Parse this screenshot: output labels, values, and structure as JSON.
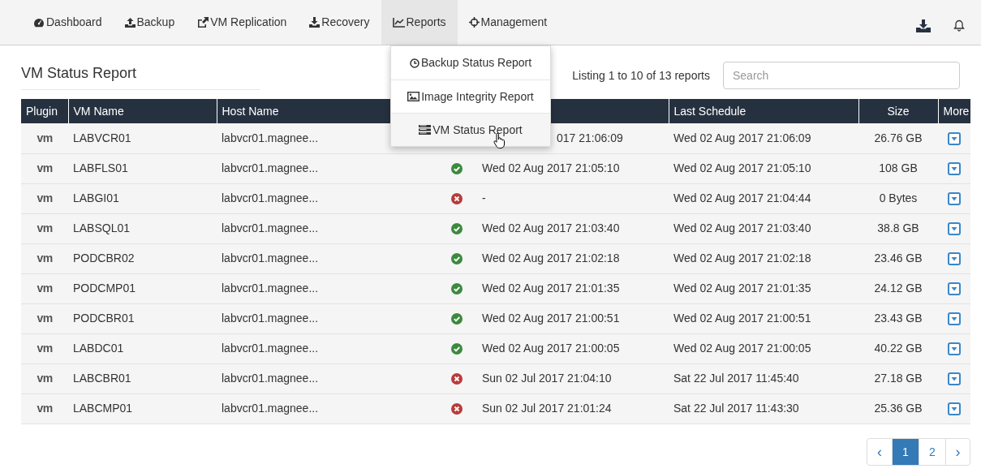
{
  "nav": {
    "items": [
      {
        "label": "Dashboard",
        "selected": false
      },
      {
        "label": "Backup",
        "selected": false
      },
      {
        "label": "VM Replication",
        "selected": false
      },
      {
        "label": "Recovery",
        "selected": false
      },
      {
        "label": "Reports",
        "selected": true
      },
      {
        "label": "Management",
        "selected": false
      }
    ]
  },
  "reports_menu": {
    "items": [
      {
        "label": "Backup Status Report",
        "selected": false
      },
      {
        "label": "Image Integrity Report",
        "selected": false
      },
      {
        "label": "VM Status Report",
        "selected": true
      }
    ]
  },
  "page_title": "VM Status Report",
  "listing": "Listing 1 to 10 of 13 reports",
  "search": {
    "placeholder": "Search"
  },
  "table": {
    "columns": [
      "Plugin",
      "VM Name",
      "Host Name",
      "Last Schedule",
      "Size",
      "More"
    ],
    "rows": [
      {
        "plugin": "vm",
        "vm_name": "LABVCR01",
        "host": "labvcr01.magnee...",
        "last_run": "017 21:06:09",
        "last_schedule": "Wed 02 Aug 2017 21:06:09",
        "size": "26.76 GB"
      },
      {
        "plugin": "vm",
        "vm_name": "LABFLS01",
        "host": "labvcr01.magnee...",
        "succeeded": true,
        "last_run": "Wed 02 Aug 2017 21:05:10",
        "last_schedule": "Wed 02 Aug 2017 21:05:10",
        "size": "108 GB"
      },
      {
        "plugin": "vm",
        "vm_name": "LABGI01",
        "host": "labvcr01.magnee...",
        "succeeded": false,
        "last_run": "-",
        "last_schedule": "Wed 02 Aug 2017 21:04:44",
        "size": "0 Bytes"
      },
      {
        "plugin": "vm",
        "vm_name": "LABSQL01",
        "host": "labvcr01.magnee...",
        "succeeded": true,
        "last_run": "Wed 02 Aug 2017 21:03:40",
        "last_schedule": "Wed 02 Aug 2017 21:03:40",
        "size": "38.8 GB"
      },
      {
        "plugin": "vm",
        "vm_name": "PODCBR02",
        "host": "labvcr01.magnee...",
        "succeeded": true,
        "last_run": "Wed 02 Aug 2017 21:02:18",
        "last_schedule": "Wed 02 Aug 2017 21:02:18",
        "size": "23.46 GB"
      },
      {
        "plugin": "vm",
        "vm_name": "PODCMP01",
        "host": "labvcr01.magnee...",
        "succeeded": true,
        "last_run": "Wed 02 Aug 2017 21:01:35",
        "last_schedule": "Wed 02 Aug 2017 21:01:35",
        "size": "24.12 GB"
      },
      {
        "plugin": "vm",
        "vm_name": "PODCBR01",
        "host": "labvcr01.magnee...",
        "succeeded": true,
        "last_run": "Wed 02 Aug 2017 21:00:51",
        "last_schedule": "Wed 02 Aug 2017 21:00:51",
        "size": "23.43 GB"
      },
      {
        "plugin": "vm",
        "vm_name": "LABDC01",
        "host": "labvcr01.magnee...",
        "succeeded": true,
        "last_run": "Wed 02 Aug 2017 21:00:05",
        "last_schedule": "Wed 02 Aug 2017 21:00:05",
        "size": "40.22 GB"
      },
      {
        "plugin": "vm",
        "vm_name": "LABCBR01",
        "host": "labvcr01.magnee...",
        "succeeded": false,
        "last_run": "Sun 02 Jul 2017 21:04:10",
        "last_schedule": "Sat 22 Jul 2017 11:45:40",
        "size": "27.18 GB"
      },
      {
        "plugin": "vm",
        "vm_name": "LABCMP01",
        "host": "labvcr01.magnee...",
        "succeeded": false,
        "last_run": "Sun 02 Jul 2017 21:01:24",
        "last_schedule": "Sat 22 Jul 2017 11:43:30",
        "size": "25.36 GB"
      }
    ]
  },
  "pagination": {
    "prev": "‹",
    "pages": [
      {
        "label": "1",
        "selected": true
      },
      {
        "label": "2",
        "selected": false
      }
    ],
    "next": "›"
  }
}
